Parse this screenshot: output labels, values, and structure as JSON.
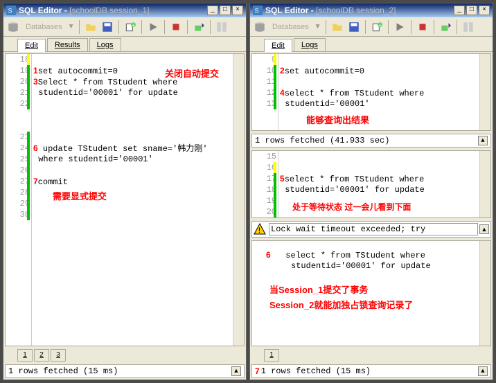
{
  "left": {
    "title_prefix": "SQL Editor - ",
    "title_session": "[schoolDB session_1]",
    "db_label": "Databases",
    "tabs": {
      "edit": "Edit",
      "results": "Results",
      "logs": "Logs"
    },
    "lines": {
      "l18": "18",
      "l19": "19",
      "l20": "20",
      "l21": "21",
      "l22": "22",
      "l23": "23",
      "l24": "24",
      "l25": "25",
      "l26": "26",
      "l27": "27",
      "l28": "28",
      "l29": "29",
      "l30": "30"
    },
    "code": {
      "c19": "set autocommit=0",
      "c20": "Select * from TStudent where",
      "c21": " studentid='00001' for update",
      "c24": "update TStudent set sname='韩力刚'",
      "c25": " where studentid='00001'",
      "c27": "commit"
    },
    "anno": {
      "n1": "1",
      "n3": "3",
      "n6": "6",
      "n7": "7",
      "a1": "关闭自动提交",
      "a2": "需要显式提交"
    },
    "btabs": {
      "b1": "1",
      "b2": "2",
      "b3": "3"
    },
    "status": "1 rows fetched (15 ms)"
  },
  "right": {
    "title_prefix": "SQL Editor - ",
    "title_session": "[schoolDB session_2]",
    "db_label": "Databases",
    "tabs": {
      "edit": "Edit",
      "logs": "Logs"
    },
    "lines": {
      "l9": "9",
      "l10": "10",
      "l11": "11",
      "l12": "12",
      "l13": "13",
      "l15": "15",
      "l16": "16",
      "l17": "17",
      "l18": "18",
      "l19": "19",
      "l20": "20"
    },
    "code": {
      "c10": "set autocommit=0",
      "c12": "select * from TStudent where",
      "c13": " studentid='00001'",
      "c17": "select * from TStudent where",
      "c18": " studentid='00001' for update",
      "b1": "select * from TStudent where",
      "b2": " studentid='00001' for update"
    },
    "anno": {
      "n2": "2",
      "n4": "4",
      "n5": "5",
      "n6": "6",
      "n7": "7",
      "a1": "能够查询出结果",
      "a2": "处于等待状态 过一会儿看到下面",
      "a3": "当Session_1提交了事务",
      "a4": "Session_2就能加独占锁查询记录了"
    },
    "status1": "1 rows fetched (41.933 sec)",
    "warn": "Lock wait timeout exceeded; try",
    "btabs": {
      "b1": "1"
    },
    "status2": "1 rows fetched (15 ms)"
  }
}
